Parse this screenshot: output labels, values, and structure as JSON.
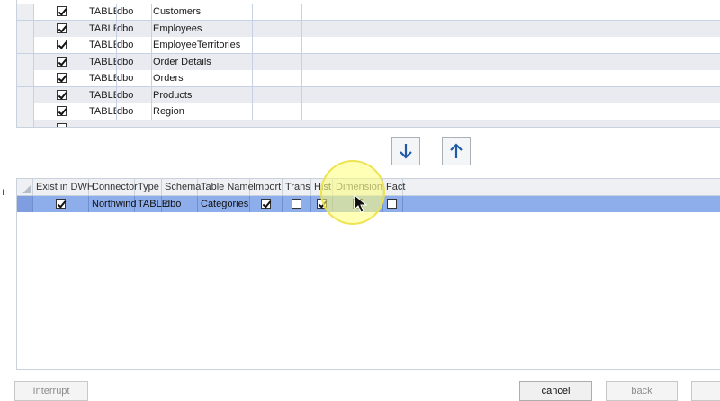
{
  "top_table": {
    "rows": [
      {
        "checked": true,
        "type": "TABLE",
        "schema": "dbo",
        "name": "Customers"
      },
      {
        "checked": true,
        "type": "TABLE",
        "schema": "dbo",
        "name": "Employees"
      },
      {
        "checked": true,
        "type": "TABLE",
        "schema": "dbo",
        "name": "EmployeeTerritories"
      },
      {
        "checked": true,
        "type": "TABLE",
        "schema": "dbo",
        "name": "Order Details"
      },
      {
        "checked": true,
        "type": "TABLE",
        "schema": "dbo",
        "name": "Orders"
      },
      {
        "checked": true,
        "type": "TABLE",
        "schema": "dbo",
        "name": "Products"
      },
      {
        "checked": true,
        "type": "TABLE",
        "schema": "dbo",
        "name": "Region"
      }
    ]
  },
  "move_buttons": {
    "down_icon": "arrow-down-icon",
    "up_icon": "arrow-up-icon",
    "accent": "#1f5aa8"
  },
  "bottom_table": {
    "headers": {
      "exist": "Exist in DWH",
      "connector": "Connector",
      "type": "Type",
      "schema": "Schema",
      "table_name": "Table Name",
      "import": "Import",
      "trans": "Trans",
      "hist": "Hist",
      "dimension": "Dimension",
      "fact": "Fact"
    },
    "rows": [
      {
        "exist": true,
        "connector": "Northwind",
        "type": "TABLE",
        "schema": "dbo",
        "table_name": "Categories",
        "import": true,
        "trans": false,
        "hist": true,
        "dimension": false,
        "fact": false
      }
    ],
    "selected_row_color": "#8eadeb"
  },
  "footer": {
    "interrupt": "Interrupt",
    "cancel": "cancel",
    "back": "back"
  },
  "left_edge_glyph": "ı"
}
